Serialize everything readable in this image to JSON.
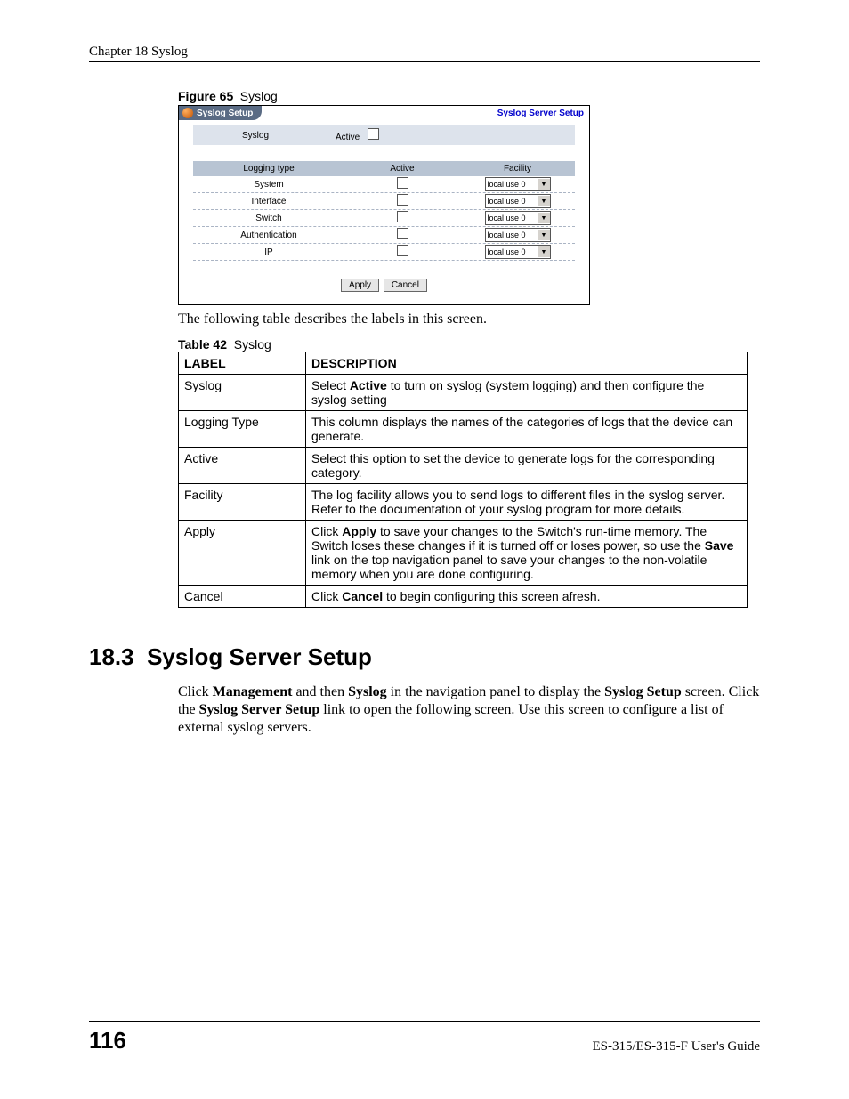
{
  "header": {
    "chapter": "Chapter 18 Syslog"
  },
  "figure": {
    "label": "Figure 65",
    "caption": "Syslog"
  },
  "shot": {
    "title": "Syslog Setup",
    "link": "Syslog Server Setup",
    "row_syslog_label": "Syslog",
    "row_syslog_active": "Active",
    "columns": {
      "c1": "Logging type",
      "c2": "Active",
      "c3": "Facility"
    },
    "rows": [
      {
        "type": "System",
        "facility": "local use 0"
      },
      {
        "type": "Interface",
        "facility": "local use 0"
      },
      {
        "type": "Switch",
        "facility": "local use 0"
      },
      {
        "type": "Authentication",
        "facility": "local use 0"
      },
      {
        "type": "IP",
        "facility": "local use 0"
      }
    ],
    "apply": "Apply",
    "cancel": "Cancel"
  },
  "para1": "The following table describes the labels in this screen.",
  "table": {
    "label": "Table 42",
    "caption": "Syslog",
    "head_label": "LABEL",
    "head_desc": "DESCRIPTION",
    "rows": [
      {
        "label": "Syslog",
        "desc_pre": "Select ",
        "bold1": "Active",
        "desc_post": " to turn on syslog (system logging) and then configure the syslog setting"
      },
      {
        "label": "Logging Type",
        "desc": "This column displays the names of the categories of logs that the device can generate."
      },
      {
        "label": "Active",
        "desc": "Select this option to set the device to generate logs for the corresponding category."
      },
      {
        "label": "Facility",
        "desc": "The log facility allows you to send logs to different files in the syslog server. Refer to the documentation of your syslog program for more details."
      },
      {
        "label": "Apply",
        "desc_pre": "Click ",
        "bold1": "Apply",
        "mid": " to save your changes to the Switch's run-time memory. The Switch loses these changes if it is turned off or loses power, so use the ",
        "bold2": "Save",
        "desc_post": " link on the top navigation panel to save your changes to the non-volatile memory when you are done configuring."
      },
      {
        "label": "Cancel",
        "desc_pre": "Click ",
        "bold1": "Cancel",
        "desc_post": " to begin configuring this screen afresh."
      }
    ]
  },
  "section": {
    "num": "18.3",
    "title": "Syslog Server Setup",
    "p_pre": "Click ",
    "b1": "Management",
    "p_mid1": " and then ",
    "b2": "Syslog",
    "p_mid2": " in the navigation panel to display the ",
    "b3": "Syslog Setup",
    "p_mid3": " screen. Click the ",
    "b4": "Syslog Server Setup",
    "p_post": " link to open the following screen. Use this screen to configure a list of external syslog servers."
  },
  "footer": {
    "page": "116",
    "doc": "ES-315/ES-315-F User's Guide"
  }
}
